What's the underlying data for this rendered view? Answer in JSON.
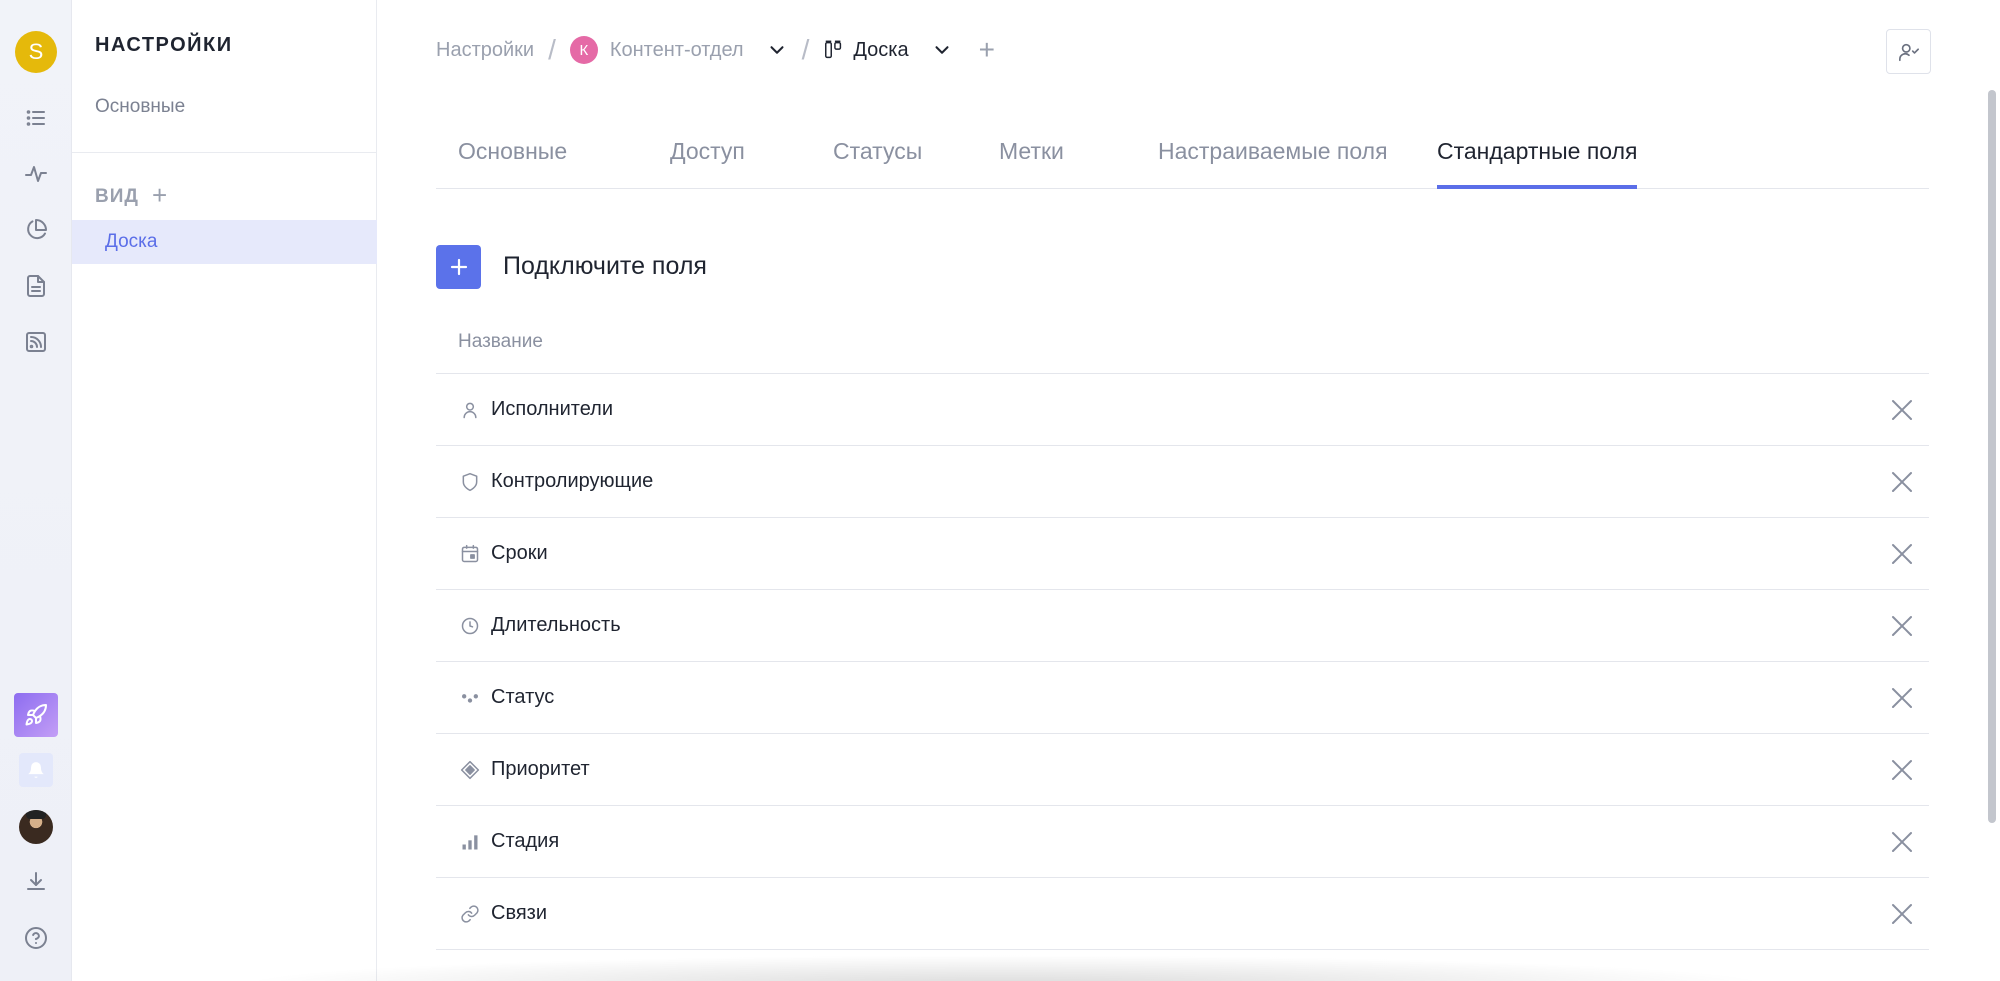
{
  "rail": {
    "user_initial": "S",
    "icons": [
      "list-icon",
      "activity-icon",
      "pie-chart-icon",
      "document-icon",
      "rss-icon"
    ],
    "bottom_icons": [
      "rocket-icon",
      "bell-icon",
      "user-photo",
      "download-icon",
      "help-icon"
    ]
  },
  "sidebar": {
    "title": "НАСТРОЙКИ",
    "general": "Основные",
    "view_section": "ВИД",
    "view_add": "+",
    "active_item": "Доска"
  },
  "breadcrumb": {
    "root": "Настройки",
    "team_initial": "К",
    "team": "Контент-отдел",
    "board": "Доска",
    "add": "+"
  },
  "tabs": [
    {
      "label": "Основные",
      "active": false
    },
    {
      "label": "Доступ",
      "active": false
    },
    {
      "label": "Статусы",
      "active": false
    },
    {
      "label": "Метки",
      "active": false
    },
    {
      "label": "Настраиваемые поля",
      "active": false
    },
    {
      "label": "Стандартные поля",
      "active": true
    }
  ],
  "fields_section": {
    "add_title": "Подключите поля",
    "column_header": "Название",
    "rows": [
      {
        "label": "Исполнители",
        "icon": "person-icon"
      },
      {
        "label": "Контролирующие",
        "icon": "shield-icon"
      },
      {
        "label": "Сроки",
        "icon": "calendar-icon"
      },
      {
        "label": "Длительность",
        "icon": "clock-icon"
      },
      {
        "label": "Статус",
        "icon": "dots-icon"
      },
      {
        "label": "Приоритет",
        "icon": "diamond-icon"
      },
      {
        "label": "Стадия",
        "icon": "bars-icon"
      },
      {
        "label": "Связи",
        "icon": "link-icon"
      }
    ]
  },
  "colors": {
    "accent": "#5b6ee8",
    "active_bg": "#e6e9fb",
    "avatar": "#e5b90b",
    "team_badge": "#e56aa6"
  }
}
